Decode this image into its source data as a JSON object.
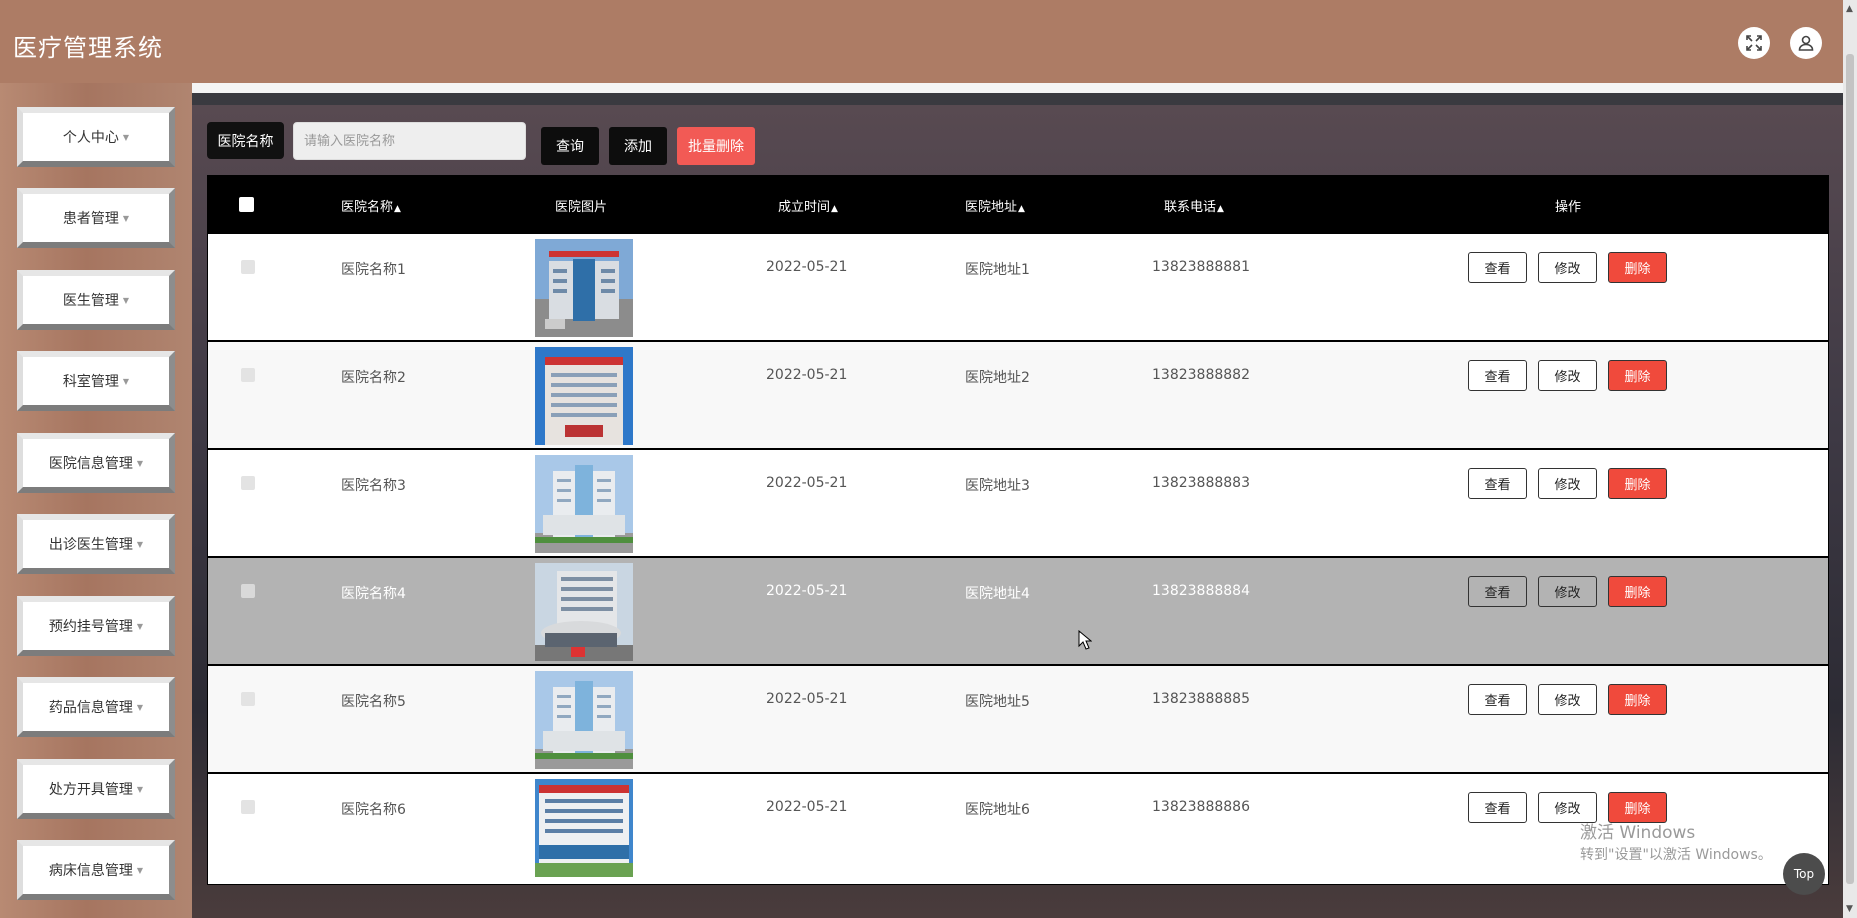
{
  "app": {
    "title": "医疗管理系统"
  },
  "header": {
    "icons": [
      "fullscreen-icon",
      "user-icon"
    ]
  },
  "sidebar": {
    "items": [
      {
        "label": "个人中心"
      },
      {
        "label": "患者管理"
      },
      {
        "label": "医生管理"
      },
      {
        "label": "科室管理"
      },
      {
        "label": "医院信息管理"
      },
      {
        "label": "出诊医生管理"
      },
      {
        "label": "预约挂号管理"
      },
      {
        "label": "药品信息管理"
      },
      {
        "label": "处方开具管理"
      },
      {
        "label": "病床信息管理"
      }
    ]
  },
  "search": {
    "label": "医院名称",
    "placeholder": "请输入医院名称",
    "value": "",
    "query_btn": "查询",
    "add_btn": "添加",
    "batch_delete_btn": "批量删除"
  },
  "table": {
    "headers": {
      "name": "医院名称",
      "image": "医院图片",
      "date": "成立时间",
      "address": "医院地址",
      "phone": "联系电话",
      "actions": "操作"
    },
    "rows": [
      {
        "name": "医院名称1",
        "date": "2022-05-21",
        "address": "医院地址1",
        "phone": "13823888881"
      },
      {
        "name": "医院名称2",
        "date": "2022-05-21",
        "address": "医院地址2",
        "phone": "13823888882"
      },
      {
        "name": "医院名称3",
        "date": "2022-05-21",
        "address": "医院地址3",
        "phone": "13823888883"
      },
      {
        "name": "医院名称4",
        "date": "2022-05-21",
        "address": "医院地址4",
        "phone": "13823888884"
      },
      {
        "name": "医院名称5",
        "date": "2022-05-21",
        "address": "医院地址5",
        "phone": "13823888885"
      },
      {
        "name": "医院名称6",
        "date": "2022-05-21",
        "address": "医院地址6",
        "phone": "13823888886"
      }
    ],
    "actions": {
      "view": "查看",
      "edit": "修改",
      "delete": "删除"
    }
  },
  "watermark": {
    "line1": "激活 Windows",
    "line2": "转到\"设置\"以激活 Windows。"
  },
  "top_button": "Top",
  "colors": {
    "header": "#ad7c65",
    "delete": "#f04a3c",
    "batch_delete": "#f25a55"
  }
}
